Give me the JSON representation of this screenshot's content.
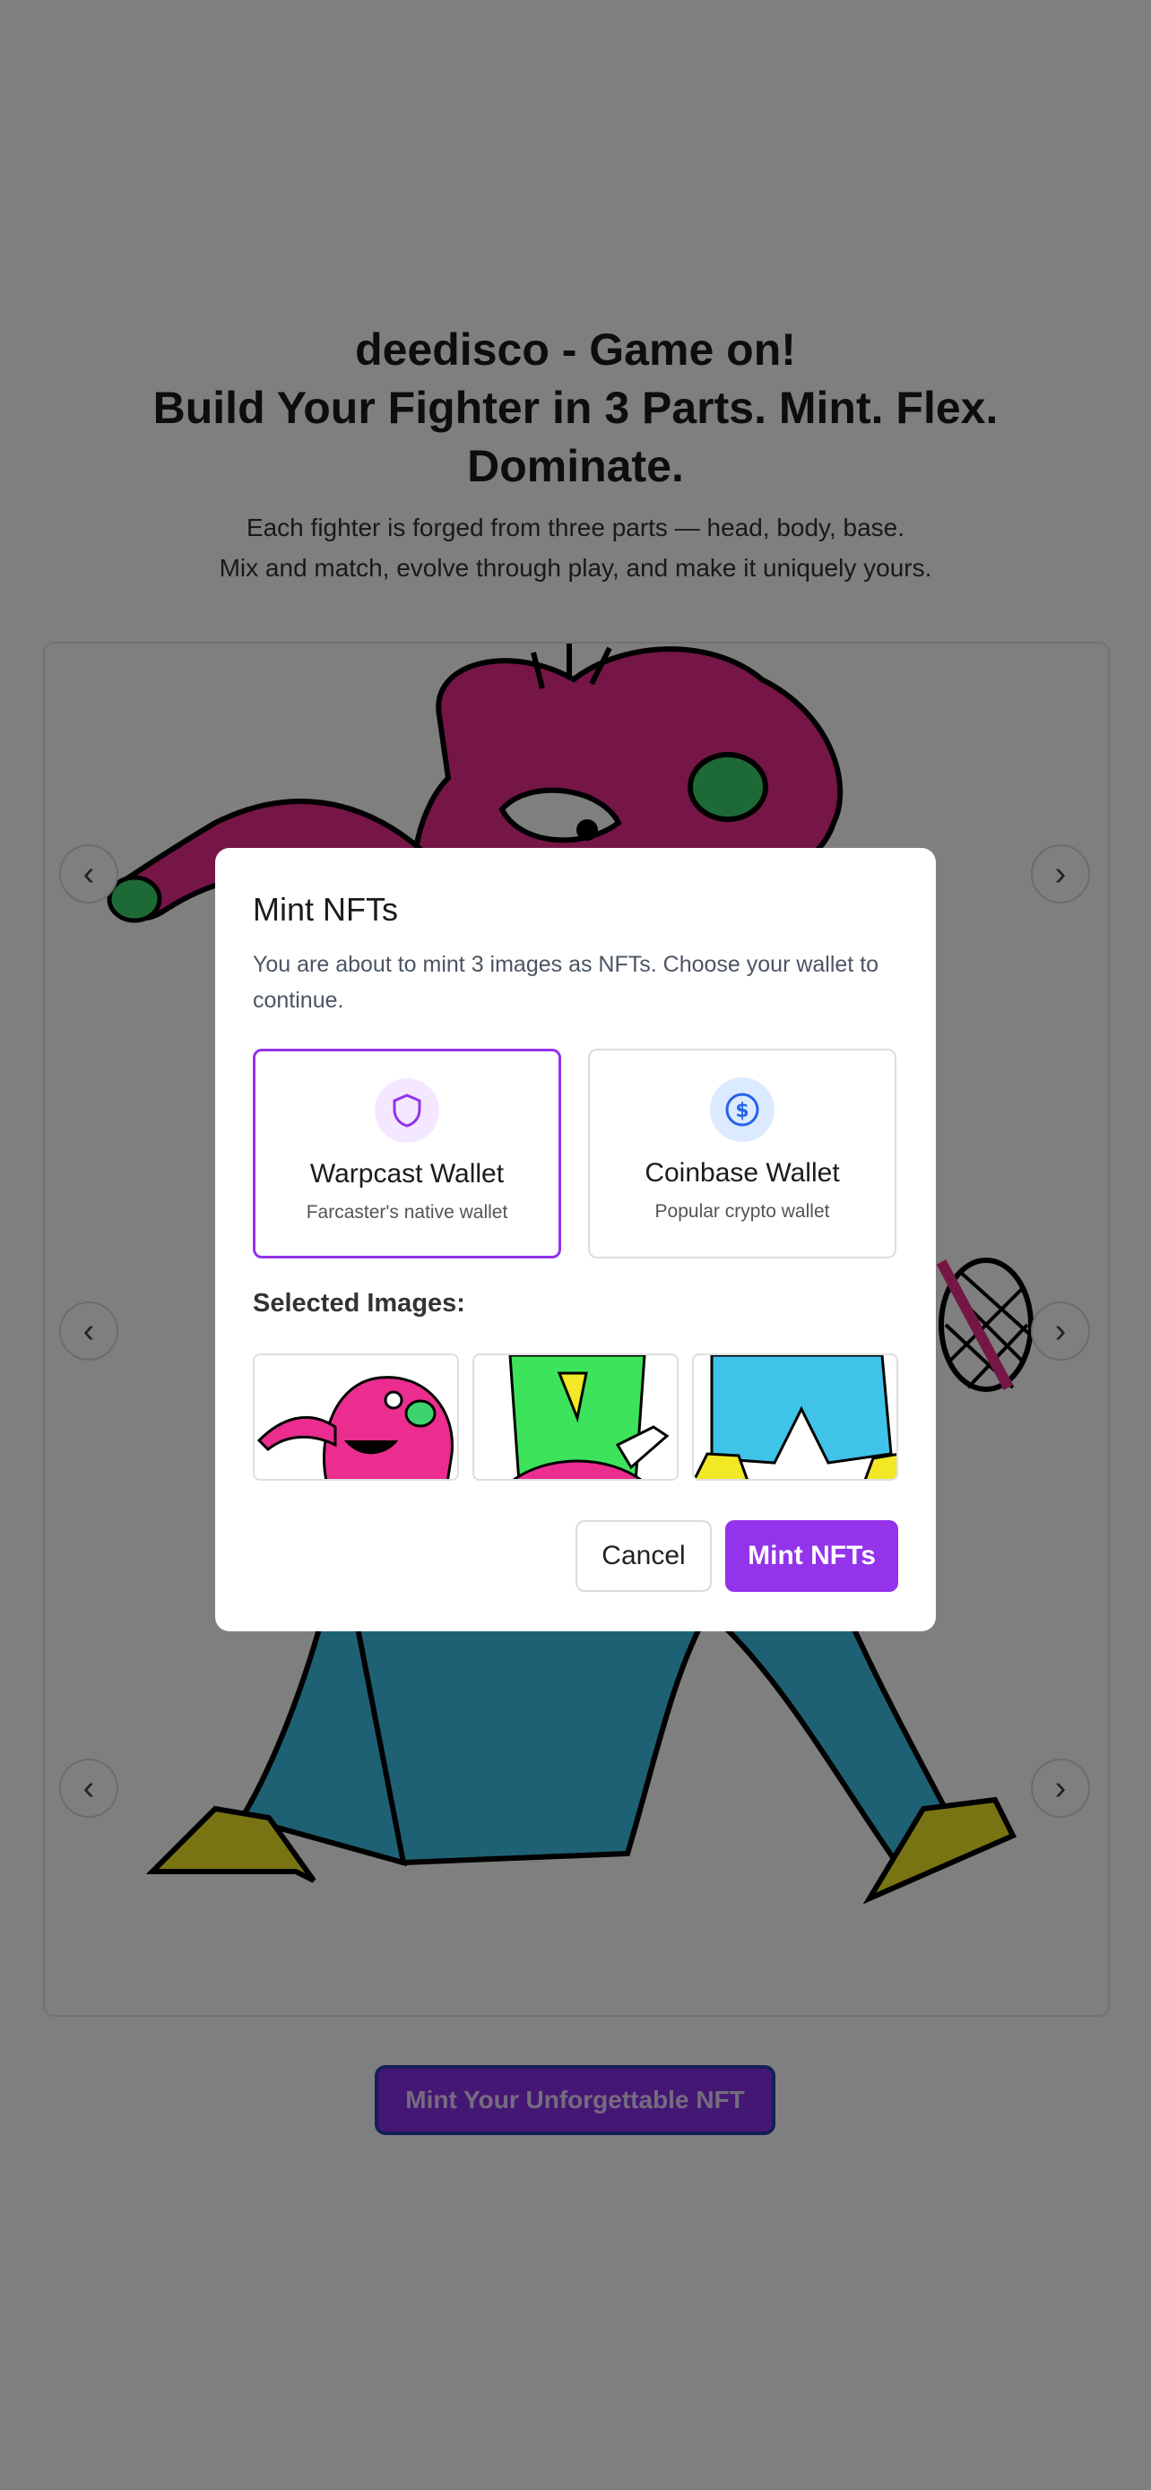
{
  "header": {
    "title_line1": "deedisco - Game on!",
    "title_line2": "Build Your Fighter in 3 Parts. Mint. Flex.",
    "title_line3": "Dominate.",
    "subtitle_line1": "Each fighter is forged from three parts — head, body, base.",
    "subtitle_line2": "Mix and match, evolve through play, and make it uniquely yours."
  },
  "carousel": {
    "prev_glyph": "‹",
    "next_glyph": "›",
    "mint_button_label": "Mint Your Unforgettable NFT"
  },
  "modal": {
    "title": "Mint NFTs",
    "description": "You are about to mint 3 images as NFTs. Choose your wallet to continue.",
    "wallets": [
      {
        "name": "Warpcast Wallet",
        "subtitle": "Farcaster's native wallet",
        "icon": "shield-icon",
        "selected": true
      },
      {
        "name": "Coinbase Wallet",
        "subtitle": "Popular crypto wallet",
        "icon": "dollar-circle-icon",
        "selected": false
      }
    ],
    "selected_images_label": "Selected Images:",
    "cancel_label": "Cancel",
    "mint_label": "Mint NFTs"
  },
  "colors": {
    "accent": "#9333ea",
    "head": "#ea2d8f",
    "body": "#3de35a",
    "base": "#3fc3e8"
  }
}
